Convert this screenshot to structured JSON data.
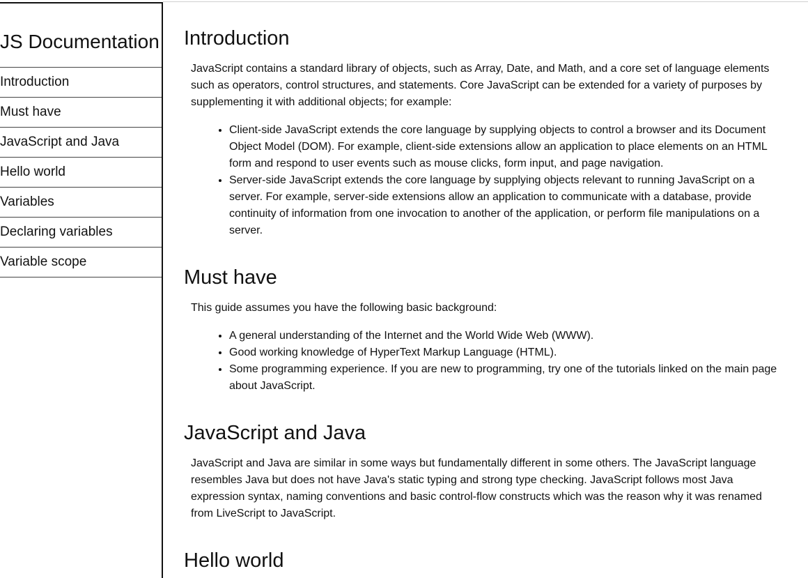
{
  "navbar": {
    "title": "JS Documentation",
    "items": [
      "Introduction",
      "Must have",
      "JavaScript and Java",
      "Hello world",
      "Variables",
      "Declaring variables",
      "Variable scope"
    ]
  },
  "sections": [
    {
      "title": "Introduction",
      "paragraph": "JavaScript contains a standard library of objects, such as Array, Date, and Math, and a core set of language elements such as operators, control structures, and statements. Core JavaScript can be extended for a variety of purposes by supplementing it with additional objects; for example:",
      "list": [
        "Client-side JavaScript extends the core language by supplying objects to control a browser and its Document Object Model (DOM). For example, client-side extensions allow an application to place elements on an HTML form and respond to user events such as mouse clicks, form input, and page navigation.",
        "Server-side JavaScript extends the core language by supplying objects relevant to running JavaScript on a server. For example, server-side extensions allow an application to communicate with a database, provide continuity of information from one invocation to another of the application, or perform file manipulations on a server."
      ]
    },
    {
      "title": "Must have",
      "paragraph": "This guide assumes you have the following basic background:",
      "list": [
        "A general understanding of the Internet and the World Wide Web (WWW).",
        "Good working knowledge of HyperText Markup Language (HTML).",
        "Some programming experience. If you are new to programming, try one of the tutorials linked on the main page about JavaScript."
      ]
    },
    {
      "title": "JavaScript and Java",
      "paragraph": "JavaScript and Java are similar in some ways but fundamentally different in some others. The JavaScript language resembles Java but does not have Java's static typing and strong type checking. JavaScript follows most Java expression syntax, naming conventions and basic control-flow constructs which was the reason why it was renamed from LiveScript to JavaScript."
    },
    {
      "title": "Hello world"
    }
  ]
}
